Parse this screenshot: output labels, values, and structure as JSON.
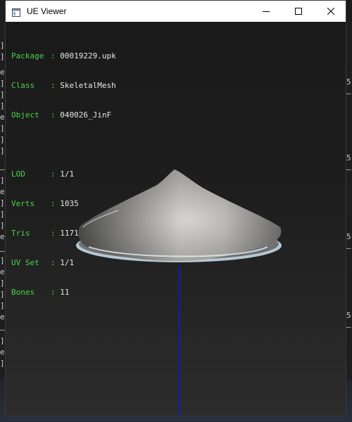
{
  "window": {
    "title": "UE Viewer",
    "icon": "app-window-icon"
  },
  "info": {
    "package": {
      "label": "Package",
      "value": "00019229.upk"
    },
    "class": {
      "label": "Class",
      "value": "SkeletalMesh"
    },
    "object": {
      "label": "Object",
      "value": "040026_JinF"
    },
    "lod": {
      "label": "LOD",
      "value": "1/1"
    },
    "verts": {
      "label": "Verts",
      "value": "1035"
    },
    "tris": {
      "label": "Tris",
      "value": "1171"
    },
    "uvset": {
      "label": "UV Set",
      "value": "1/1"
    },
    "bones": {
      "label": "Bones",
      "value": "11"
    }
  },
  "colors": {
    "label_green": "#4cd24c",
    "axis_blue": "#1020b0"
  }
}
